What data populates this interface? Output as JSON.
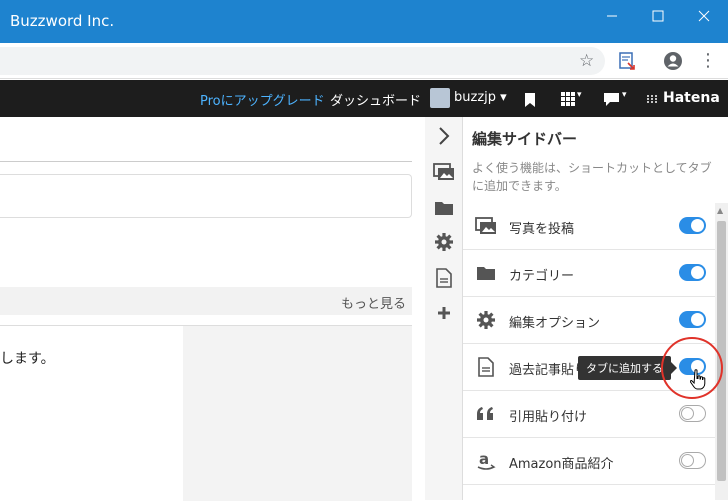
{
  "window": {
    "title": "Buzzword Inc."
  },
  "topnav": {
    "upgrade": "Proにアップグレード",
    "dashboard": "ダッシュボード",
    "username": "buzzjp",
    "brand": "Hatena"
  },
  "main": {
    "more": "もっと見る",
    "body_text": "します。"
  },
  "sidebar": {
    "title": "編集サイドバー",
    "description": "よく使う機能は、ショートカットとしてタブに追加できます。",
    "items": [
      {
        "label": "写真を投稿",
        "icon": "photo-icon",
        "enabled": true
      },
      {
        "label": "カテゴリー",
        "icon": "folder-icon",
        "enabled": true
      },
      {
        "label": "編集オプション",
        "icon": "gear-icon",
        "enabled": true
      },
      {
        "label": "過去記事貼り",
        "icon": "document-icon",
        "enabled": true
      },
      {
        "label": "引用貼り付け",
        "icon": "quote-icon",
        "enabled": false
      },
      {
        "label": "Amazon商品紹介",
        "icon": "amazon-icon",
        "enabled": false
      }
    ]
  },
  "tooltip": {
    "text": "タブに追加する"
  },
  "colors": {
    "titlebar": "#1e83cf",
    "accent": "#2a8de6",
    "highlight": "#e0332a"
  }
}
